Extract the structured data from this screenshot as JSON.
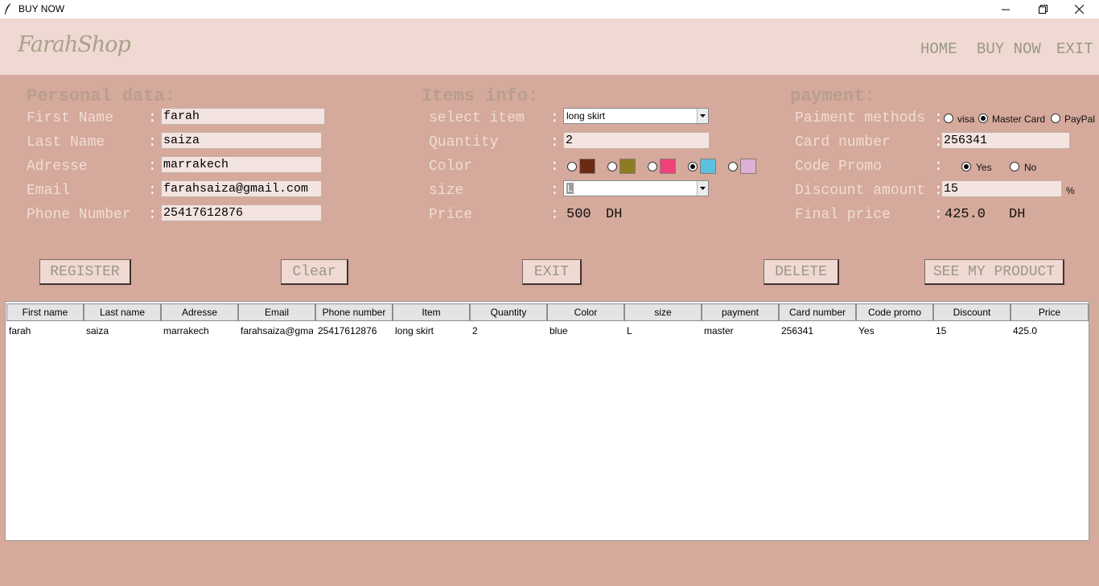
{
  "window": {
    "title": "BUY NOW"
  },
  "header": {
    "logo": "FarahShop",
    "nav": [
      "HOME",
      "BUY NOW",
      "EXIT"
    ]
  },
  "personal": {
    "title": "Personal data:",
    "fields": [
      {
        "label": "First Name",
        "value": "farah"
      },
      {
        "label": "Last Name",
        "value": "saiza"
      },
      {
        "label": "Adresse",
        "value": "marrakech"
      },
      {
        "label": "Email",
        "value": "farahsaiza@gmail.com"
      },
      {
        "label": "Phone Number",
        "value": "25417612876"
      }
    ]
  },
  "items": {
    "title": "Items info:",
    "select_item_label": "select item",
    "select_item_value": "long skirt",
    "quantity_label": "Quantity",
    "quantity_value": "2",
    "color_label": "Color",
    "colors": [
      {
        "hex": "#6a2a14",
        "selected": false
      },
      {
        "hex": "#8c7d22",
        "selected": false
      },
      {
        "hex": "#f0427a",
        "selected": false
      },
      {
        "hex": "#5bc1df",
        "selected": true
      },
      {
        "hex": "#ddb1d6",
        "selected": false
      }
    ],
    "size_label": "size",
    "size_value": "L",
    "price_label": "Price",
    "price_value": "500",
    "price_unit": "DH"
  },
  "payment": {
    "title": "payment:",
    "methods_label": "Paiment methods",
    "methods": [
      {
        "label": "visa",
        "selected": false
      },
      {
        "label": "Master Card",
        "selected": true
      },
      {
        "label": "PayPal",
        "selected": false
      }
    ],
    "card_label": "Card number",
    "card_value": "256341",
    "promo_label": "Code Promo",
    "promo_options": [
      {
        "label": "Yes",
        "selected": true
      },
      {
        "label": "No",
        "selected": false
      }
    ],
    "discount_label": "Discount amount",
    "discount_value": "15",
    "discount_unit": "%",
    "final_label": "Final price",
    "final_value": "425.0",
    "final_unit": "DH"
  },
  "buttons": {
    "register": "REGISTER",
    "clear": "Clear",
    "exit": "EXIT",
    "delete": "DELETE",
    "see": "SEE MY PRODUCT"
  },
  "table": {
    "columns": [
      "First name",
      "Last name",
      "Adresse",
      "Email",
      "Phone number",
      "Item",
      "Quantity",
      "Color",
      "size",
      "payment",
      "Card number",
      "Code promo",
      "Discount",
      "Price"
    ],
    "rows": [
      [
        "farah",
        "saiza",
        "marrakech",
        "farahsaiza@gma",
        "25417612876",
        "long skirt",
        "2",
        "blue",
        "L",
        "master",
        "256341",
        "Yes",
        "15",
        "425.0"
      ]
    ]
  },
  "colors": {
    "background": "#d5a99b",
    "header": "#efd9d2",
    "label": "#f0ddd6"
  },
  "icons": {
    "app": "feather-icon",
    "minimize": "minimize-icon",
    "maximize": "restore-icon",
    "close": "close-icon",
    "dropdown": "chevron-down-icon"
  }
}
